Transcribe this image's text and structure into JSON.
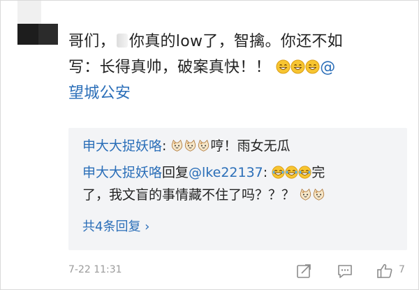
{
  "comment": {
    "line1_a": "哥们，",
    "line1_b": "你真的low了，智擒。你还不如",
    "line2": "写：长得真帅，破案真快！！",
    "mention_at": "@",
    "line3_mention": "望城公安"
  },
  "replies": [
    {
      "user": "申大大捉妖咯",
      "sep": ": ",
      "text": "哼！雨女无瓜"
    },
    {
      "user": "申大大捉妖咯",
      "mid": "回复",
      "to": "@lke22137",
      "sep": ":",
      "text1": "完",
      "text2": "了，我文盲的事情藏不住了吗？？？"
    }
  ],
  "more_replies": "共4条回复 ›",
  "footer": {
    "timestamp": "7-22 11:31",
    "like_count": "7"
  },
  "icons": [
    "smile-emoji-icon",
    "cat-emoji-icon",
    "laugh-cry-emoji-icon",
    "share-icon",
    "reply-icon",
    "thumbs-up-icon"
  ],
  "colors": {
    "link": "#2a6eb8",
    "reply_bg": "#f3f4f6",
    "meta": "#9b9b9b"
  }
}
